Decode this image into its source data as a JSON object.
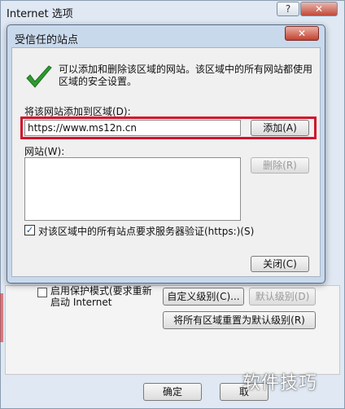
{
  "background_window": {
    "title": "Internet 选项",
    "help_label": "?",
    "close_label": "✕",
    "protected_mode_label": "启用保护模式(要求重新启动 Internet",
    "custom_level_label": "自定义级别(C)...",
    "default_level_label": "默认级别(D)",
    "reset_all_label": "将所有区域重置为默认级别(R)",
    "ok_label": "确定",
    "cancel_label": "取",
    "watermark": "软件技巧"
  },
  "dialog": {
    "title": "受信任的站点",
    "close_label": "✕",
    "info_text": "可以添加和删除该区域的网站。该区域中的所有网站都使用区域的安全设置。",
    "add_label": "将该网站添加到区域(D):",
    "url_value": "https://www.ms12n.cn",
    "add_button": "添加(A)",
    "sites_label": "网站(W):",
    "remove_button": "删除(R)",
    "verify_label": "对该区域中的所有站点要求服务器验证(https:)(S)",
    "verify_checked": true,
    "close_button": "关闭(C)"
  },
  "colors": {
    "highlight": "#d0142a",
    "check_green": "#2f9a2f"
  }
}
